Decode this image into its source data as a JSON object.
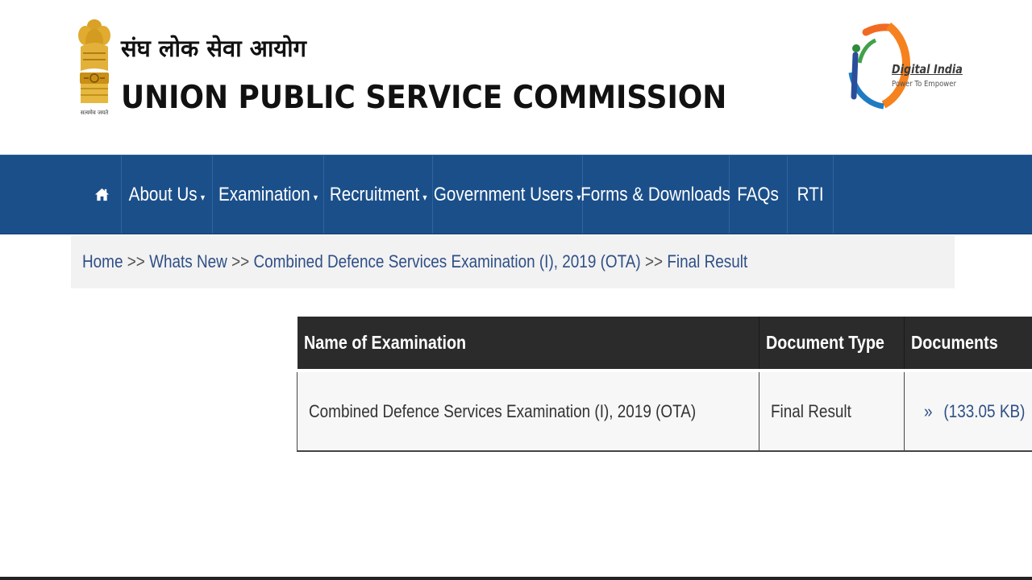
{
  "header": {
    "hindi_title": "संघ लोक सेवा आयोग",
    "english_title": "UNION PUBLIC SERVICE COMMISSION",
    "emblem_caption": "सत्यमेव जयते",
    "digital_india": {
      "name": "Digital India",
      "tagline": "Power To Empower"
    }
  },
  "nav": {
    "home_icon": "home-icon",
    "items": [
      {
        "label": "About Us",
        "dropdown": true
      },
      {
        "label": "Examination",
        "dropdown": true
      },
      {
        "label": "Recruitment",
        "dropdown": true
      },
      {
        "label": "Government Users",
        "dropdown": true
      },
      {
        "label": "Forms & Downloads",
        "dropdown": false
      },
      {
        "label": "FAQs",
        "dropdown": false
      },
      {
        "label": "RTI",
        "dropdown": false
      }
    ],
    "caret": "▾"
  },
  "breadcrumb": {
    "items": [
      "Home",
      "Whats New",
      "Combined Defence Services Examination (I), 2019 (OTA)",
      "Final Result"
    ],
    "separator": ">>"
  },
  "table": {
    "headers": [
      "Name of Examination",
      "Document Type",
      "Documents"
    ],
    "rows": [
      {
        "exam": "Combined Defence Services Examination (I), 2019 (OTA)",
        "doc_type": "Final Result",
        "doc_prefix": "»",
        "doc_size": "(133.05 KB)",
        "doc_icon": "pdf-icon"
      }
    ]
  },
  "colors": {
    "nav_bg": "#1b4f8a",
    "table_header_bg": "#2b2b2b",
    "link": "#2f4f86",
    "breadcrumb_bg": "#f2f2f2"
  }
}
